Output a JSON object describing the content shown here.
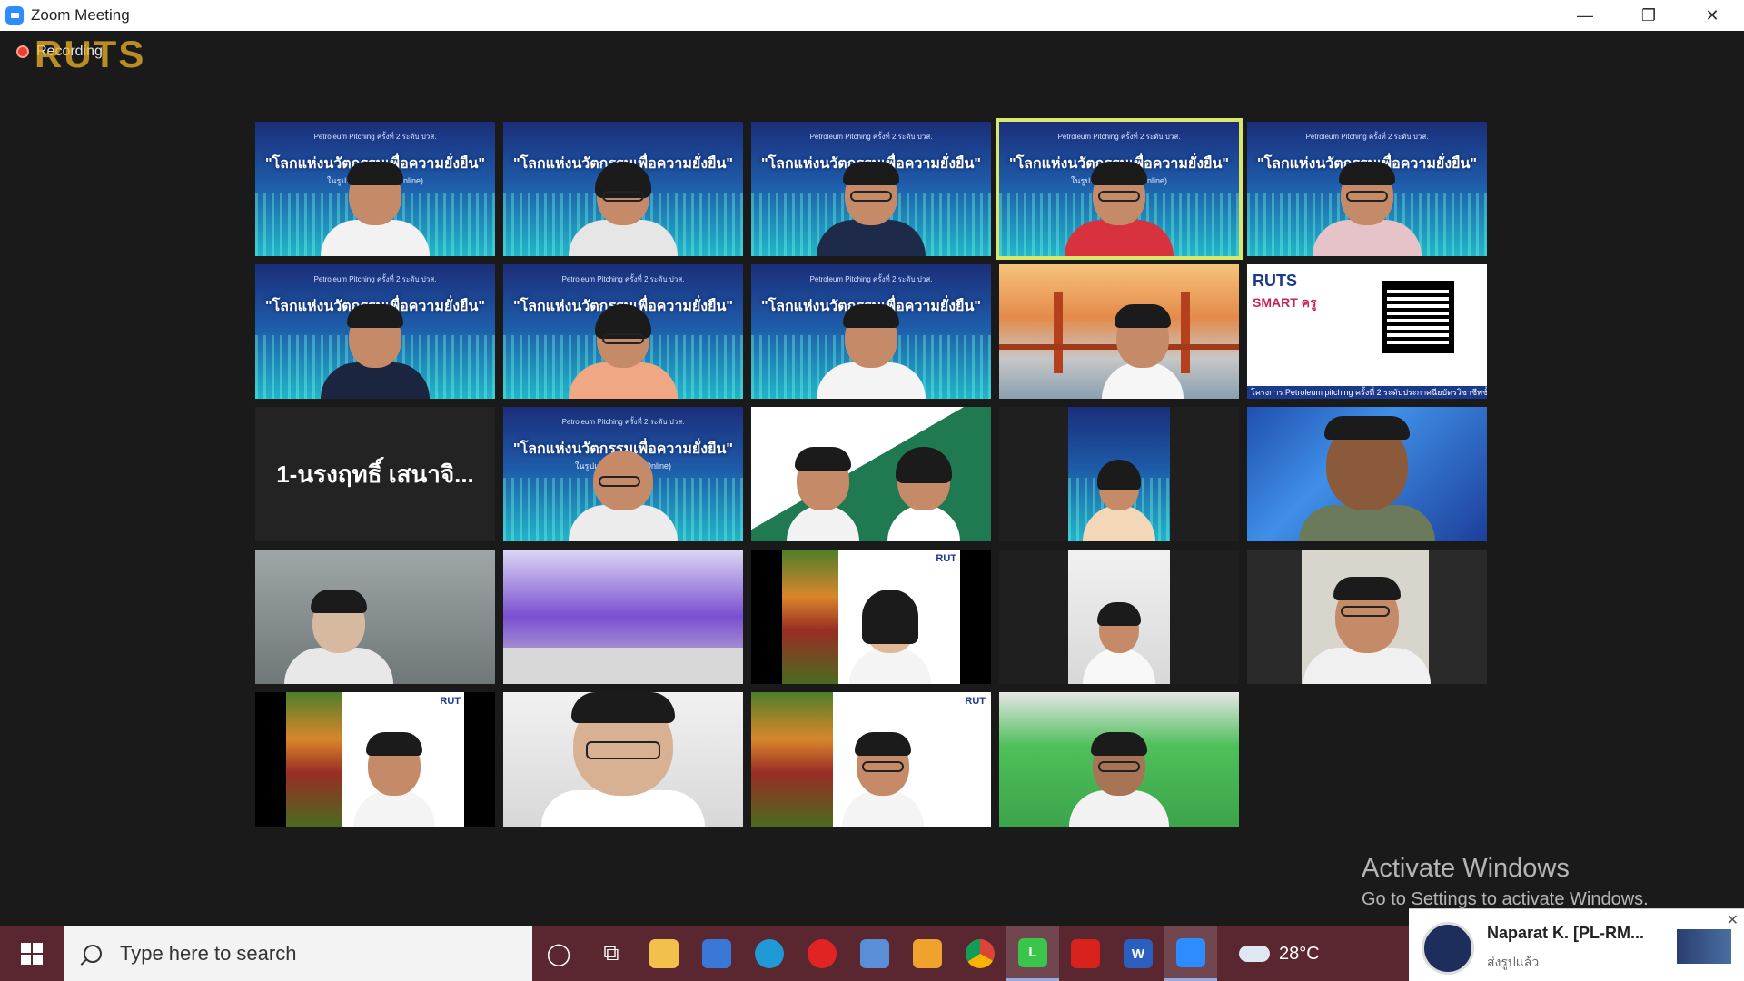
{
  "window": {
    "title": "Zoom Meeting",
    "minimize_icon": "—",
    "maximize_icon": "❐",
    "close_icon": "✕"
  },
  "recording": {
    "label": "Recording",
    "watermark": "RUTS"
  },
  "banner": {
    "small": "Petroleum Pitching ครั้งที่ 2 ระดับ ปวส.",
    "big": "\"โลกแห่งนวัตกรรมเพื่อความยั่งยืน\"",
    "sub": "ในรูปแบบออนไลน์ (Online)"
  },
  "tiles": {
    "name_tile": "1-นรงฤทธิ์ เสนาจิ...",
    "qr_logo": "RUTS",
    "qr_smart": "SMART ครู",
    "qr_caption": "โครงการ Petroleum pitching ครั้งที่ 2 ระดับประกาศนียบัตรวิชาชีพชั้นสูง",
    "veg_logo": "RUT"
  },
  "activation": {
    "title": "Activate Windows",
    "subtitle": "Go to Settings to activate Windows."
  },
  "taskbar": {
    "search_placeholder": "Type here to search",
    "temperature": "28°C",
    "apps": [
      "cortana-icon",
      "task-view-icon",
      "file-explorer-icon",
      "store-icon",
      "edge-icon",
      "opera-icon",
      "mail-icon",
      "outlook-icon",
      "chrome-icon",
      "line-icon",
      "acrobat-icon",
      "word-icon",
      "zoom-icon"
    ]
  },
  "notification": {
    "sender": "Naparat K. [PL-RM...",
    "message": "ส่งรูปแล้ว",
    "close": "✕"
  },
  "colors": {
    "taskbar_bg": "#5a2630",
    "active_speaker_border": "#d9e86a",
    "zoom_blue": "#2d8cff"
  }
}
